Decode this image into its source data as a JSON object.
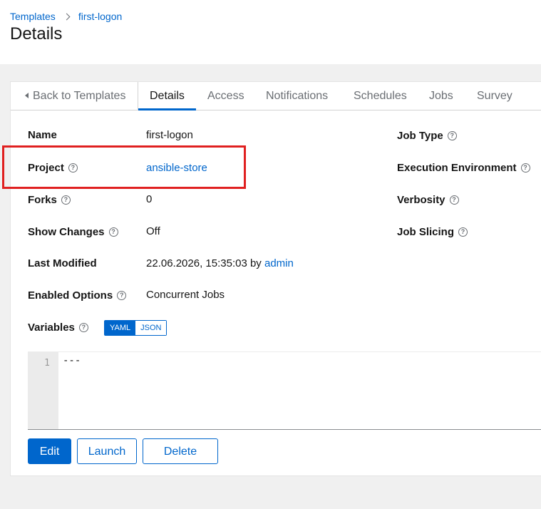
{
  "breadcrumb": {
    "parent": "Templates",
    "current": "first-logon"
  },
  "page_title": "Details",
  "tabs": {
    "back": "Back to Templates",
    "items": [
      "Details",
      "Access",
      "Notifications",
      "Schedules",
      "Jobs",
      "Survey"
    ],
    "active": "Details"
  },
  "fields": {
    "name": {
      "label": "Name",
      "value": "first-logon"
    },
    "project": {
      "label": "Project",
      "value": "ansible-store"
    },
    "forks": {
      "label": "Forks",
      "value": "0"
    },
    "show_changes": {
      "label": "Show Changes",
      "value": "Off"
    },
    "last_modified": {
      "label": "Last Modified",
      "value": "22.06.2026, 15:35:03 by",
      "user": "admin"
    },
    "enabled_options": {
      "label": "Enabled Options",
      "value": "Concurrent Jobs"
    },
    "variables": {
      "label": "Variables",
      "modes": [
        "YAML",
        "JSON"
      ],
      "selected": "YAML"
    },
    "job_type": {
      "label": "Job Type"
    },
    "execution_environment": {
      "label": "Execution Environment"
    },
    "verbosity": {
      "label": "Verbosity"
    },
    "job_slicing": {
      "label": "Job Slicing"
    }
  },
  "editor": {
    "line_number": "1",
    "content": "---"
  },
  "actions": {
    "edit": "Edit",
    "launch": "Launch",
    "delete": "Delete"
  },
  "colors": {
    "accent": "#0066cc",
    "highlight": "#e02020"
  }
}
